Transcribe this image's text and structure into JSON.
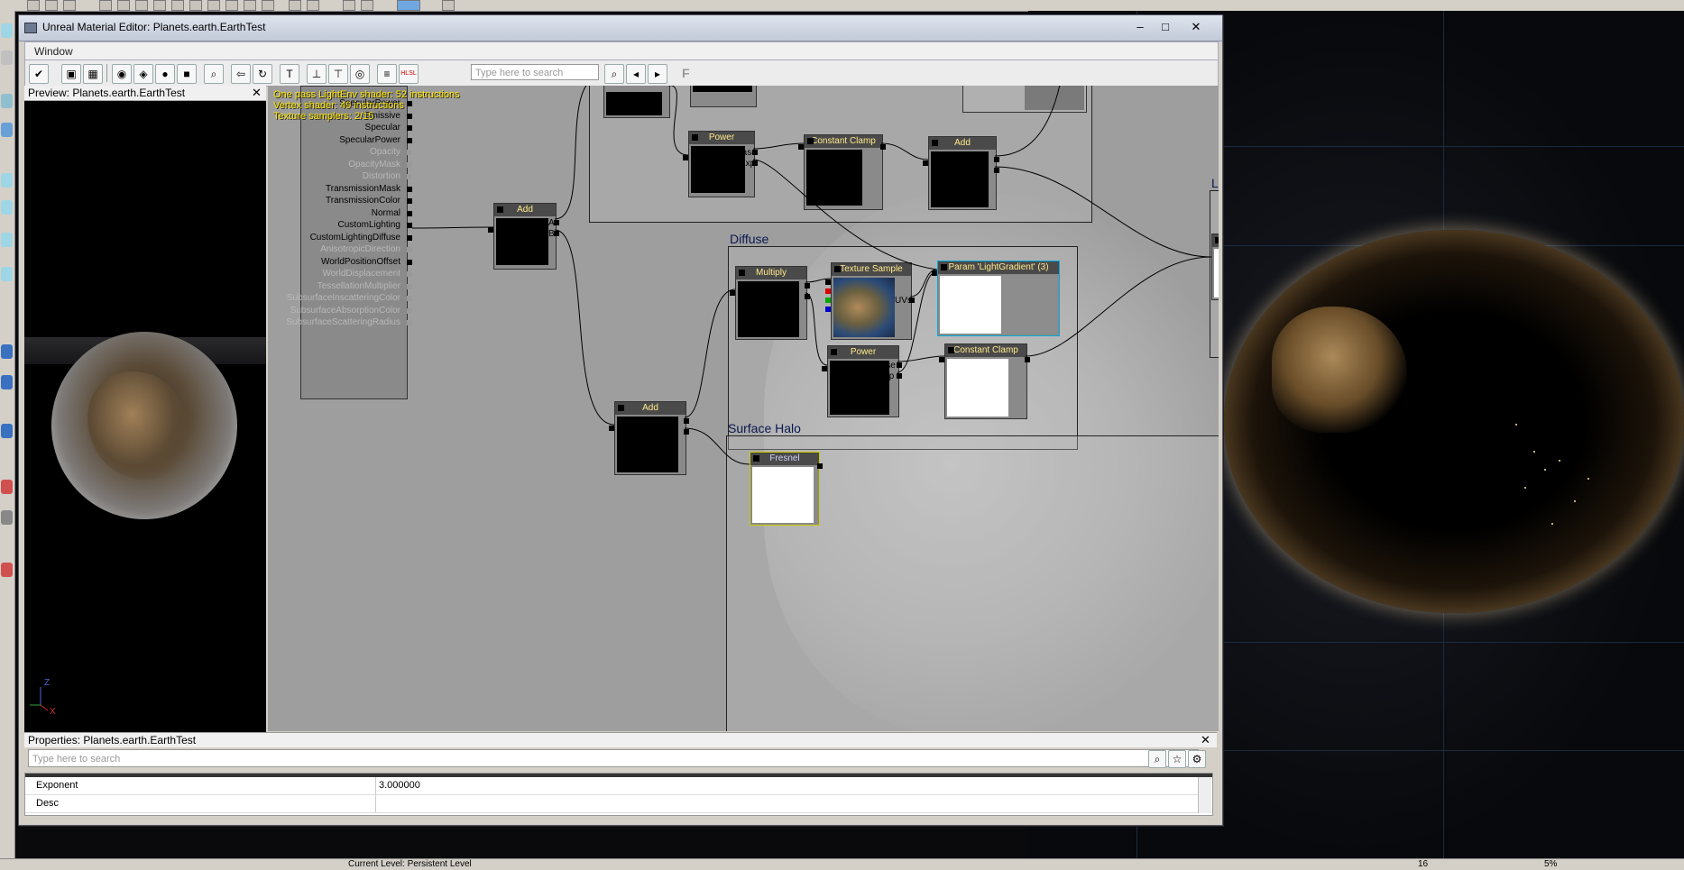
{
  "window": {
    "title": "Unreal Material Editor: Planets.earth.EarthTest",
    "minimize_label": "–",
    "maximize_label": "□",
    "close_label": "✕"
  },
  "menu": {
    "window_label": "Window"
  },
  "toolbar": {
    "search_placeholder": "Type here to search",
    "hlsl_label": "HLSL",
    "f_label": "F"
  },
  "preview": {
    "title": "Preview: Planets.earth.EarthTest",
    "close_label": "✕",
    "axis_z": "Z",
    "axis_x": "X"
  },
  "stats": {
    "line1": "One pass LightEnv shader: 52 instructions",
    "line2": "Vertex shader: 49 instructions",
    "line3": "Texture samplers: 2/15"
  },
  "material_inputs": [
    {
      "label": "SpecularPower",
      "active": true
    },
    {
      "label": "Emissive",
      "active": true
    },
    {
      "label": "Specular",
      "active": true
    },
    {
      "label": "SpecularPower",
      "active": true
    },
    {
      "label": "Opacity",
      "active": false
    },
    {
      "label": "OpacityMask",
      "active": false
    },
    {
      "label": "Distortion",
      "active": false
    },
    {
      "label": "TransmissionMask",
      "active": true
    },
    {
      "label": "TransmissionColor",
      "active": true
    },
    {
      "label": "Normal",
      "active": true
    },
    {
      "label": "CustomLighting",
      "active": true
    },
    {
      "label": "CustomLightingDiffuse",
      "active": true
    },
    {
      "label": "AnisotropicDirection",
      "active": false
    },
    {
      "label": "WorldPositionOffset",
      "active": true
    },
    {
      "label": "WorldDisplacement",
      "active": false
    },
    {
      "label": "TessellationMultiplier",
      "active": false
    },
    {
      "label": "SubsurfaceInscatteringColor",
      "active": false
    },
    {
      "label": "SubsurfaceAbsorptionColor",
      "active": false
    },
    {
      "label": "SubsurfaceScatteringRadius",
      "active": false
    }
  ],
  "nodes": {
    "add_main": "Add",
    "add_main_a": "A",
    "add_main_b": "B",
    "power_top": "Power",
    "power_top_base": "Base",
    "power_top_exp": "Exp",
    "clamp_top": "Constant Clamp",
    "add_top": "Add",
    "multiply": "Multiply",
    "texture_sample": "Texture Sample",
    "texture_uvs": "UVs",
    "param_gradient": "Param 'LightGradient' (3)",
    "power_diffuse": "Power",
    "power_diffuse_base": "Base",
    "power_diffuse_exp": "Exp",
    "clamp_diffuse": "Constant Clamp",
    "add_bottom": "Add",
    "fresnel": "Fresnel"
  },
  "groups": {
    "diffuse": "Diffuse",
    "surface_halo": "Surface Halo",
    "right_partial": "Lig"
  },
  "properties": {
    "title": "Properties: Planets.earth.EarthTest",
    "close_label": "✕",
    "search_placeholder": "Type here to search",
    "rows": [
      {
        "name": "Exponent",
        "value": "3.000000"
      },
      {
        "name": "Desc",
        "value": ""
      }
    ]
  },
  "status_bar": {
    "level_text": "Current Level: Persistent Level",
    "zoom": "5%",
    "grid": "16"
  },
  "colors": {
    "accent_yellow": "#ffe600",
    "group_title": "#0a1850",
    "node_header": "#4a4a4a"
  }
}
